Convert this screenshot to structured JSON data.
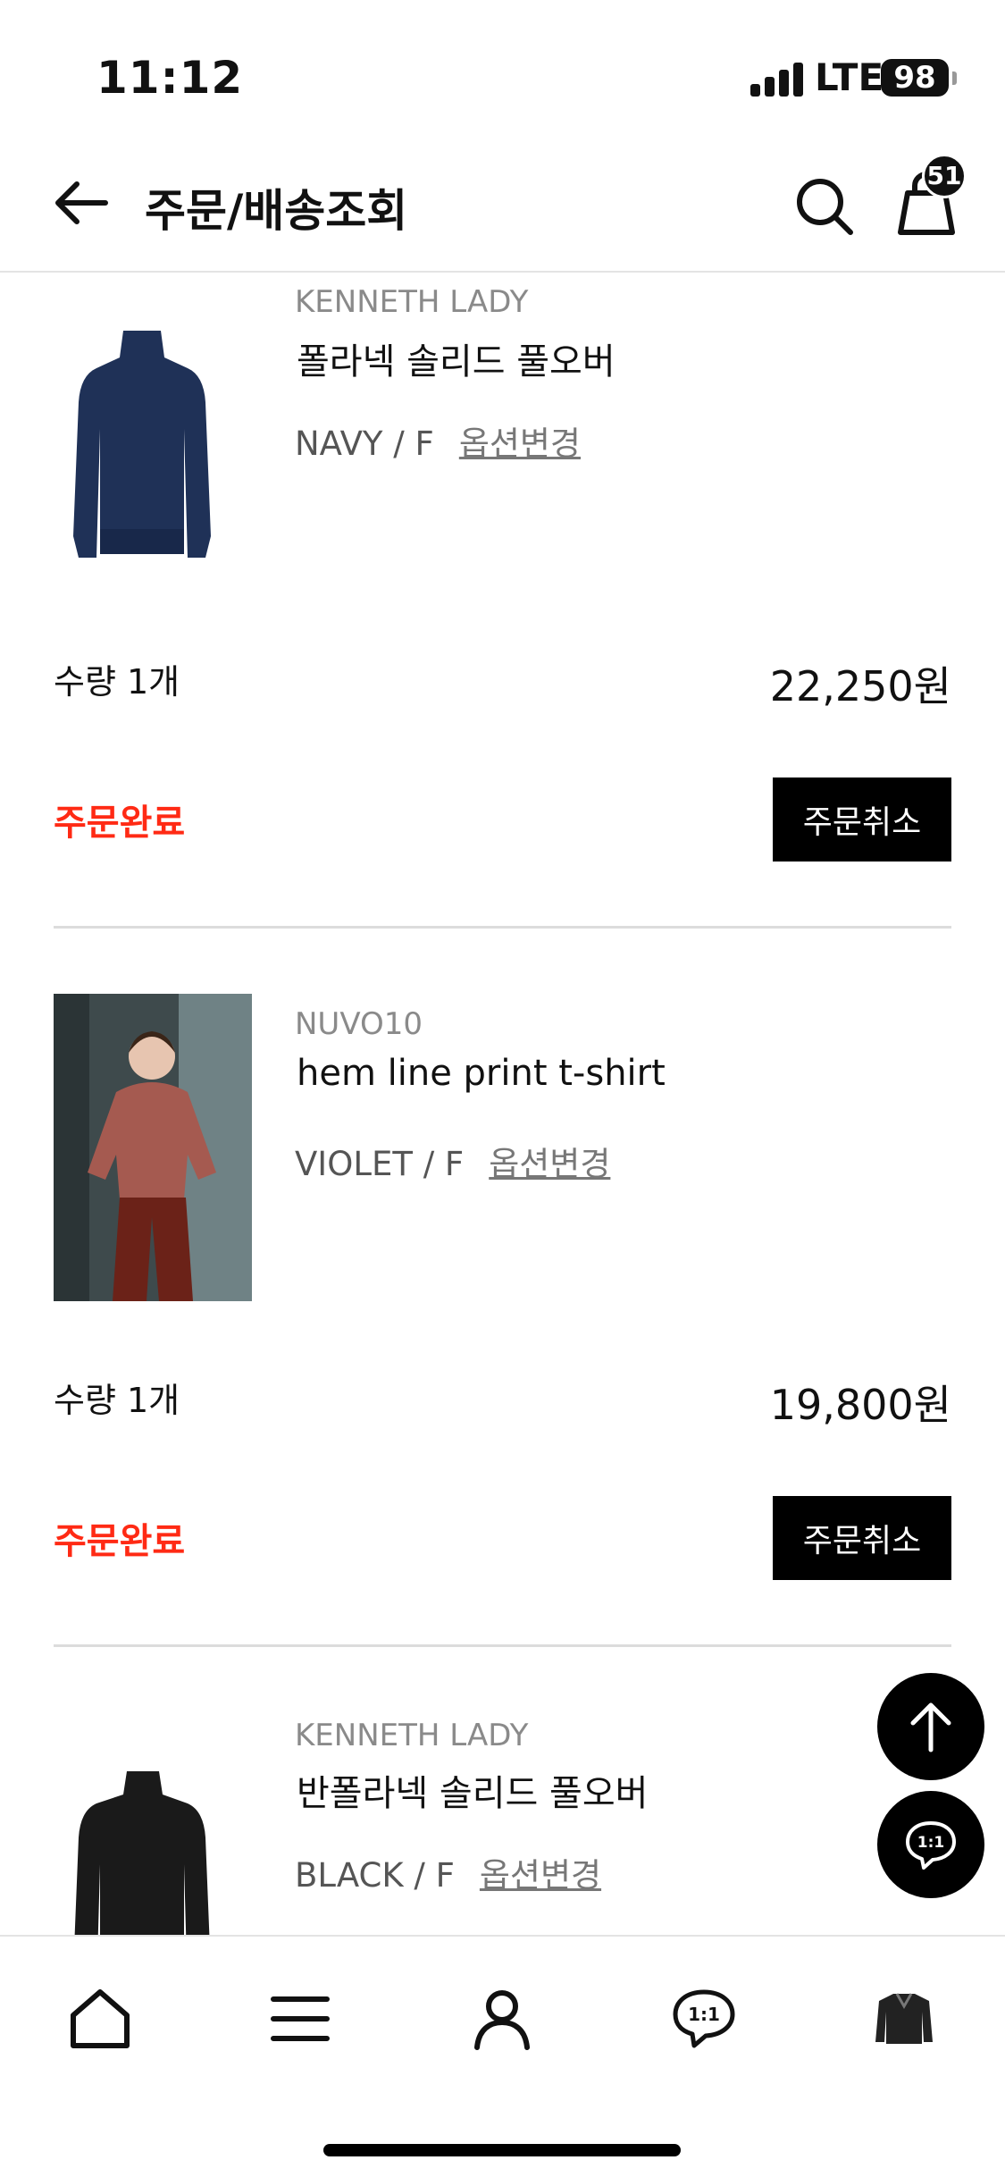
{
  "status_bar": {
    "time": "11:12",
    "network": "LTE",
    "battery": "98"
  },
  "header": {
    "title": "주문/배송조회",
    "cart_count": "51"
  },
  "orders": [
    {
      "brand": "KENNETH LADY",
      "name": "폴라넥 솔리드 풀오버",
      "option": "NAVY / F",
      "option_change": "옵션변경",
      "quantity": "수량 1개",
      "price": "22,250원",
      "status": "주문완료",
      "cancel_label": "주문취소",
      "thumb_color": "#1f3157"
    },
    {
      "brand": "NUVO10",
      "name": "hem line print t-shirt",
      "option": "VIOLET / F",
      "option_change": "옵션변경",
      "quantity": "수량 1개",
      "price": "19,800원",
      "status": "주문완료",
      "cancel_label": "주문취소",
      "thumb_color": "#8e443a"
    },
    {
      "brand": "KENNETH LADY",
      "name": "반폴라넥 솔리드 풀오버",
      "option": "BLACK / F",
      "option_change": "옵션변경",
      "thumb_color": "#1a1a1a"
    }
  ],
  "floating": {
    "top_icon": "arrow-up-icon",
    "chat_icon": "chat-1on1-icon",
    "chat_label": "1:1"
  },
  "bottom_nav": [
    {
      "icon": "home-icon"
    },
    {
      "icon": "menu-icon"
    },
    {
      "icon": "user-icon"
    },
    {
      "icon": "chat-1on1-icon",
      "label": "1:1"
    },
    {
      "icon": "recent-item-icon"
    }
  ],
  "colors": {
    "status_red": "#ff2a14",
    "button_black": "#000000",
    "divider": "#dcdcdc"
  }
}
